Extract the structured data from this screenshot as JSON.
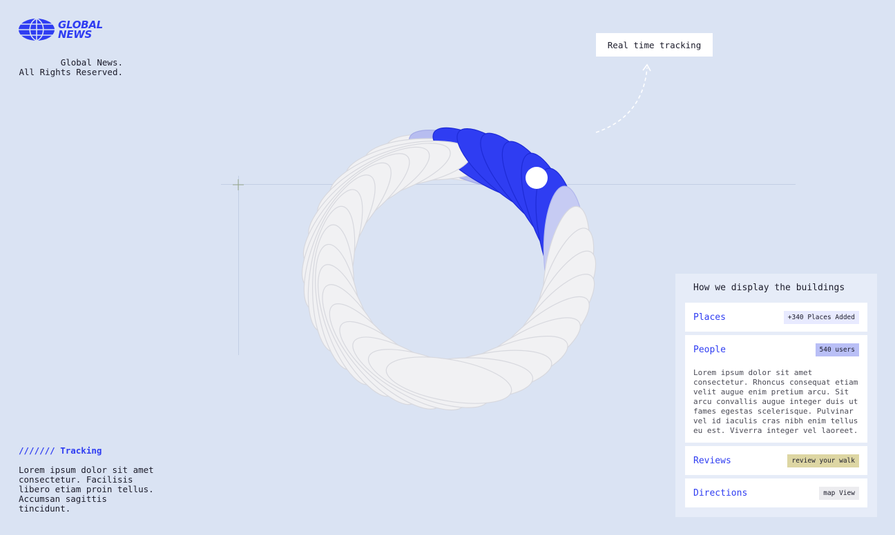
{
  "brand": {
    "line1": "GLOBAL",
    "line2": "NEWS",
    "accent": "#2f3df2",
    "icon": "globe-icon"
  },
  "copyright": {
    "text": "Global News.\nAll Rights Reserved."
  },
  "callout": {
    "label": "Real time tracking"
  },
  "tracking": {
    "title": "/////// Tracking",
    "body": "Lorem ipsum dolor sit amet consectetur. Facilisis libero etiam proin tellus. Accumsan sagittis tincidunt."
  },
  "panel": {
    "title": "How we display the buildings",
    "rows": [
      {
        "label": "Places",
        "badge": "+340 Places Added"
      },
      {
        "label": "People",
        "badge": "540 users",
        "text": "Lorem ipsum dolor sit amet consectetur. Rhoncus consequat etiam velit augue enim pretium arcu. Sit arcu convallis augue integer duis ut fames egestas scelerisque. Pulvinar vel id iaculis cras nibh enim tellus eu est. Viverra integer vel laoreet."
      },
      {
        "label": "Reviews",
        "badge": "review your walk"
      },
      {
        "label": "Directions",
        "badge": "map View"
      }
    ]
  }
}
